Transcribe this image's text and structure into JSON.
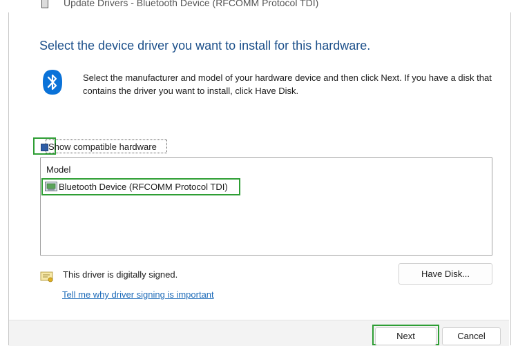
{
  "window": {
    "title": "Update Drivers - Bluetooth Device (RFCOMM Protocol TDI)"
  },
  "main": {
    "heading": "Select the device driver you want to install for this hardware.",
    "description": "Select the manufacturer and model of your hardware device and then click Next. If you have a disk that contains the driver you want to install, click Have Disk.",
    "icons": {
      "header": "bluetooth-icon",
      "driver_row": "device-driver-icon",
      "signed": "certificate-icon"
    }
  },
  "compatible": {
    "label": "Show compatible hardware",
    "checked": true
  },
  "model_list": {
    "header": "Model",
    "items": [
      "Bluetooth Device (RFCOMM Protocol TDI)"
    ],
    "selected_index": 0
  },
  "signing": {
    "status": "This driver is digitally signed.",
    "link": "Tell me why driver signing is important"
  },
  "buttons": {
    "have_disk": "Have Disk...",
    "next": "Next",
    "cancel": "Cancel"
  },
  "colors": {
    "heading": "#1b4f8a",
    "link": "#1c6ab8",
    "highlight_outline": "#2e9e34",
    "bluetooth": "#0a72d8"
  }
}
